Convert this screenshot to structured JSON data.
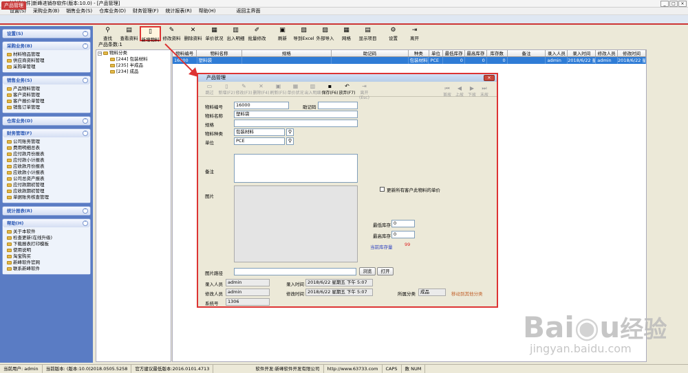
{
  "window": {
    "title": "[新峰软件]新峰进销存软件(版本:10.0) - [产品管理]",
    "buttons": [
      "_",
      "□",
      "×"
    ]
  },
  "menu": [
    "设置(S)",
    "采购业务(B)",
    "销售业务(S)",
    "仓库业务(D)",
    "财务管理(F)",
    "统计报表(R)",
    "帮助(H)",
    "返回主界面"
  ],
  "active_tab": "产品管理",
  "sidebar": [
    {
      "title": "设置(S)",
      "items": []
    },
    {
      "title": "采购业务(B)",
      "items": [
        "材料物品管理",
        "供应商资料管理",
        "采购单管理"
      ]
    },
    {
      "title": "销售业务(S)",
      "items": [
        "产品物料管理",
        "客户资料管理",
        "客户报价单管理",
        "销售订单管理"
      ]
    },
    {
      "title": "仓库业务(D)",
      "items": []
    },
    {
      "title": "财务管理(F)",
      "items": [
        "公司账务管理",
        "费用明细总表",
        "应付款月份报表",
        "应付款小计报表",
        "应收款月份报表",
        "应收款小计报表",
        "公司总资产报表",
        "应付款期初管理",
        "应收款期初管理",
        "单据账务核查管理"
      ]
    },
    {
      "title": "统计报表(R)",
      "items": []
    },
    {
      "title": "帮助(H)",
      "items": [
        "关于本软件",
        "检查更新(在线升级)",
        "下载报表打印模板",
        "使用说明",
        "淘宝购买",
        "新峰软件官网",
        "联系新峰软件"
      ]
    }
  ],
  "toolbar": [
    {
      "label": "查找",
      "icon": "binoculars-icon",
      "glyph": "⚲"
    },
    {
      "label": "查看资料",
      "icon": "view-icon",
      "glyph": "▤"
    },
    {
      "label": "新增物料",
      "icon": "new-file-icon",
      "glyph": "▯",
      "highlight": true
    },
    {
      "label": "修改资料",
      "icon": "edit-icon",
      "glyph": "✎"
    },
    {
      "label": "删除资料",
      "icon": "delete-icon",
      "glyph": "✕"
    },
    {
      "label": "单价状况",
      "icon": "price-icon",
      "glyph": "▦"
    },
    {
      "label": "出入明细",
      "icon": "detail-icon",
      "glyph": "▥"
    },
    {
      "label": "批量修改",
      "icon": "batch-edit-icon",
      "glyph": "✐"
    },
    {
      "label": "刷新",
      "icon": "refresh-icon",
      "glyph": "▣"
    },
    {
      "label": "导到Excel",
      "icon": "excel-icon",
      "glyph": "▧"
    },
    {
      "label": "外部导入",
      "icon": "import-icon",
      "glyph": "▨"
    },
    {
      "label": "网格",
      "icon": "grid-icon",
      "glyph": "▦"
    },
    {
      "label": "显示项目",
      "icon": "columns-icon",
      "glyph": "▤"
    },
    {
      "label": "设置",
      "icon": "settings-icon",
      "glyph": "⚙"
    },
    {
      "label": "离开",
      "icon": "exit-icon",
      "glyph": "⇥"
    }
  ],
  "record_count": "产品条数:1",
  "tree": {
    "root": "物料分类",
    "children": [
      "[244] 包装材料",
      "[235] 半成品",
      "[234] 成品"
    ]
  },
  "grid": {
    "columns": [
      "物料编号",
      "物料名称",
      "规格",
      "助记码",
      "种类",
      "单位",
      "最低库存",
      "最高库存",
      "库存数",
      "备注",
      "录入人员",
      "录入时间",
      "修改人员",
      "修改时间"
    ],
    "rows": [
      [
        "16000",
        "塑料袋",
        "",
        "",
        "包装材料",
        "PCE",
        "0",
        "0",
        "0",
        "",
        "admin",
        "2018/6/22 星期",
        "admin",
        "2018/6/22 星期"
      ]
    ]
  },
  "dialog": {
    "title": "产品管理",
    "toolbar": [
      {
        "label": "跳过",
        "enabled": false,
        "glyph": "▭"
      },
      {
        "label": "新增(F2)",
        "enabled": false,
        "glyph": "▯"
      },
      {
        "label": "修改(F3)",
        "enabled": false,
        "glyph": "✎"
      },
      {
        "label": "删除(F4)",
        "enabled": false,
        "glyph": "✕"
      },
      {
        "label": "刷新(F5)",
        "enabled": false,
        "glyph": "▣"
      },
      {
        "label": "单价状况",
        "enabled": false,
        "glyph": "▦"
      },
      {
        "label": "出入明细",
        "enabled": false,
        "glyph": "▥"
      },
      {
        "label": "保存(F6)",
        "enabled": true,
        "glyph": "▪"
      },
      {
        "label": "放弃(F7)",
        "enabled": true,
        "glyph": "↶"
      },
      {
        "label": "离开(Esc)",
        "enabled": false,
        "glyph": "⇥"
      }
    ],
    "nav": [
      "首故",
      "上故",
      "下故",
      "末故"
    ],
    "labels": {
      "code": "物料编号",
      "mnemonic": "助记码",
      "name": "物料名称",
      "spec": "规格",
      "category": "物料种类",
      "unit": "单位",
      "remark": "备注",
      "image": "图片",
      "update_price": "更新所有客户此物料的单价",
      "min_stock": "最低库存",
      "max_stock": "最高库存",
      "current_stock": "当前库存量",
      "image_path": "图片路径",
      "browse": "浏览",
      "open": "打开",
      "creator": "录入人员",
      "create_time": "录入时间",
      "modifier": "修改人员",
      "modify_time": "修改时间",
      "system_no": "系统号",
      "belong_category": "所属分类",
      "move_category": "移动到其他分类"
    },
    "values": {
      "code": "16000",
      "mnemonic": "",
      "name": "塑料袋",
      "spec": "",
      "category": "包装材料",
      "unit": "PCE",
      "remark": "",
      "min_stock": "0",
      "max_stock": "0",
      "current_stock": "99",
      "image_path": "",
      "creator": "admin",
      "create_time": "2018/6/22 星期五 下午 5:07",
      "modifier": "admin",
      "modify_time": "2018/6/22 星期五 下午 5:07",
      "system_no": "1306",
      "belong_category": "成品"
    }
  },
  "statusbar": [
    "当前用户: admin",
    "当前版本: (版本:10.0)2018.0505.5258",
    "官方建议最低版本:2016.0101.4713",
    "软件开发:新峰软件开发有限公司",
    "http://www.63733.com",
    "CAPS",
    "数 NUM"
  ],
  "watermark": {
    "text": "Baidu经验",
    "sub": "jingyan.baidu.com"
  },
  "colors": {
    "highlight_red": "#dd3333",
    "selection_blue": "#2f7cd6",
    "sidebar_blue": "#5a7cc4",
    "link_orange": "#c0602a"
  }
}
